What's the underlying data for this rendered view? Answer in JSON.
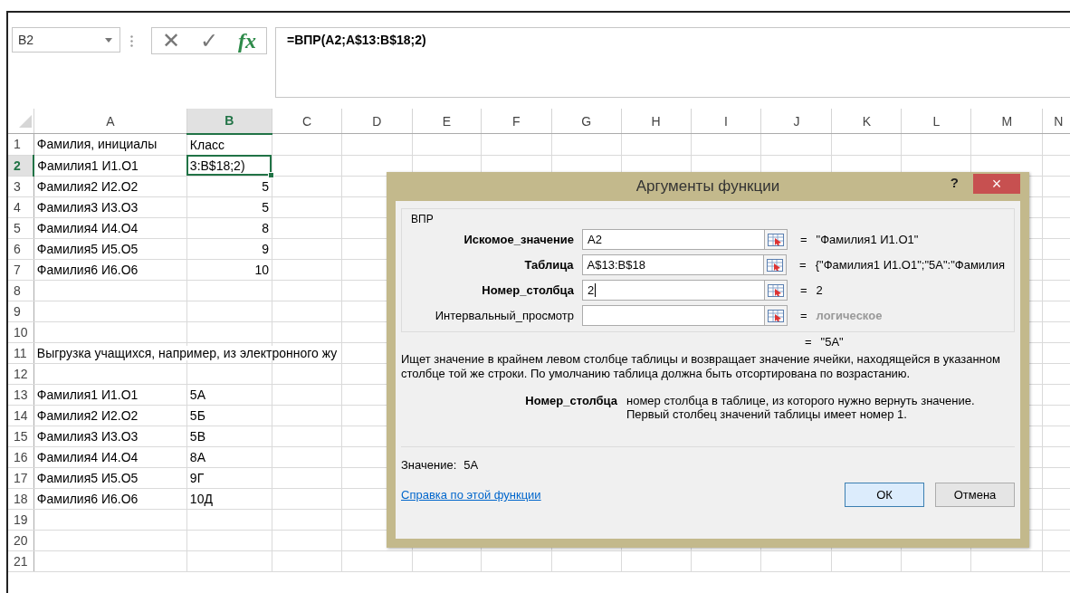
{
  "name_box": {
    "value": "B2"
  },
  "formula_bar": {
    "cancel": "✕",
    "enter": "✓",
    "fx": "fx",
    "value": "=ВПР(A2;A$13:B$18;2)"
  },
  "columns": [
    {
      "label": "A",
      "selected": false
    },
    {
      "label": "B",
      "selected": true
    },
    {
      "label": "C",
      "selected": false
    },
    {
      "label": "D",
      "selected": false
    },
    {
      "label": "E",
      "selected": false
    },
    {
      "label": "F",
      "selected": false
    },
    {
      "label": "G",
      "selected": false
    },
    {
      "label": "H",
      "selected": false
    },
    {
      "label": "I",
      "selected": false
    },
    {
      "label": "J",
      "selected": false
    },
    {
      "label": "K",
      "selected": false
    },
    {
      "label": "L",
      "selected": false
    },
    {
      "label": "M",
      "selected": false
    },
    {
      "label": "N",
      "selected": false
    }
  ],
  "rows": [
    {
      "number": "1",
      "selected": false,
      "cells": [
        {
          "text": "Фамилия, инициалы",
          "kind": "text",
          "selected": false
        },
        {
          "text": "Класс",
          "kind": "text",
          "selected": false
        }
      ]
    },
    {
      "number": "2",
      "selected": true,
      "cells": [
        {
          "text": "Фамилия1 И1.О1",
          "kind": "text",
          "selected": false
        },
        {
          "text": "3:B$18;2)",
          "kind": "text",
          "selected": true
        }
      ]
    },
    {
      "number": "3",
      "selected": false,
      "cells": [
        {
          "text": "Фамилия2 И2.О2",
          "kind": "text",
          "selected": false
        },
        {
          "text": "5",
          "kind": "number",
          "selected": false
        }
      ]
    },
    {
      "number": "4",
      "selected": false,
      "cells": [
        {
          "text": "Фамилия3 И3.О3",
          "kind": "text",
          "selected": false
        },
        {
          "text": "5",
          "kind": "number",
          "selected": false
        }
      ]
    },
    {
      "number": "5",
      "selected": false,
      "cells": [
        {
          "text": "Фамилия4 И4.О4",
          "kind": "text",
          "selected": false
        },
        {
          "text": "8",
          "kind": "number",
          "selected": false
        }
      ]
    },
    {
      "number": "6",
      "selected": false,
      "cells": [
        {
          "text": "Фамилия5 И5.О5",
          "kind": "text",
          "selected": false
        },
        {
          "text": "9",
          "kind": "number",
          "selected": false
        }
      ]
    },
    {
      "number": "7",
      "selected": false,
      "cells": [
        {
          "text": "Фамилия6 И6.О6",
          "kind": "text",
          "selected": false
        },
        {
          "text": "10",
          "kind": "number",
          "selected": false
        }
      ]
    },
    {
      "number": "8",
      "selected": false,
      "cells": []
    },
    {
      "number": "9",
      "selected": false,
      "cells": []
    },
    {
      "number": "10",
      "selected": false,
      "cells": []
    },
    {
      "number": "11",
      "selected": false,
      "cells": [
        {
          "text": "Выгрузка учащихся, например, из электронного жу",
          "kind": "overflow",
          "selected": false
        }
      ]
    },
    {
      "number": "12",
      "selected": false,
      "cells": []
    },
    {
      "number": "13",
      "selected": false,
      "cells": [
        {
          "text": "Фамилия1 И1.О1",
          "kind": "text",
          "selected": false
        },
        {
          "text": "5А",
          "kind": "text",
          "selected": false
        }
      ]
    },
    {
      "number": "14",
      "selected": false,
      "cells": [
        {
          "text": "Фамилия2 И2.О2",
          "kind": "text",
          "selected": false
        },
        {
          "text": "5Б",
          "kind": "text",
          "selected": false
        }
      ]
    },
    {
      "number": "15",
      "selected": false,
      "cells": [
        {
          "text": "Фамилия3 И3.О3",
          "kind": "text",
          "selected": false
        },
        {
          "text": "5В",
          "kind": "text",
          "selected": false
        }
      ]
    },
    {
      "number": "16",
      "selected": false,
      "cells": [
        {
          "text": "Фамилия4 И4.О4",
          "kind": "text",
          "selected": false
        },
        {
          "text": "8А",
          "kind": "text",
          "selected": false
        }
      ]
    },
    {
      "number": "17",
      "selected": false,
      "cells": [
        {
          "text": "Фамилия5 И5.О5",
          "kind": "text",
          "selected": false
        },
        {
          "text": "9Г",
          "kind": "text",
          "selected": false
        }
      ]
    },
    {
      "number": "18",
      "selected": false,
      "cells": [
        {
          "text": "Фамилия6 И6.О6",
          "kind": "text",
          "selected": false
        },
        {
          "text": "10Д",
          "kind": "text",
          "selected": false
        }
      ]
    },
    {
      "number": "19",
      "selected": false,
      "cells": []
    },
    {
      "number": "20",
      "selected": false,
      "cells": []
    },
    {
      "number": "21",
      "selected": false,
      "cells": []
    }
  ],
  "dialog": {
    "title": "Аргументы функции",
    "help": "?",
    "close": "×",
    "function_name": "ВПР",
    "arguments": [
      {
        "label": "Искомое_значение",
        "required": true,
        "value": "A2",
        "focused": false,
        "sign": "=",
        "result": "\"Фамилия1 И1.О1\""
      },
      {
        "label": "Таблица",
        "required": true,
        "value": "A$13:B$18",
        "focused": false,
        "sign": "=",
        "result": "{\"Фамилия1 И1.О1\";\"5А\":\"Фамилия"
      },
      {
        "label": "Номер_столбца",
        "required": true,
        "value": "2",
        "focused": true,
        "sign": "=",
        "result": "2"
      },
      {
        "label": "Интервальный_просмотр",
        "required": false,
        "focused": false,
        "sign": "=",
        "result": "логическое"
      }
    ],
    "formula_sign": "=",
    "formula_result": "\"5А\"",
    "description": "Ищет значение в крайнем левом столбце таблицы и возвращает значение ячейки, находящейся в указанном столбце той же строки. По умолчанию таблица должна быть отсортирована по возрастанию.",
    "param_name": "Номер_столбца",
    "param_help": "номер столбца в таблице, из которого нужно вернуть значение. Первый столбец значений таблицы имеет номер 1.",
    "value_label": "Значение:",
    "value": "5А",
    "help_link": "Справка по этой функции",
    "buttons": [
      {
        "label": "ОК",
        "default": true
      },
      {
        "label": "Отмена",
        "default": false
      }
    ]
  }
}
